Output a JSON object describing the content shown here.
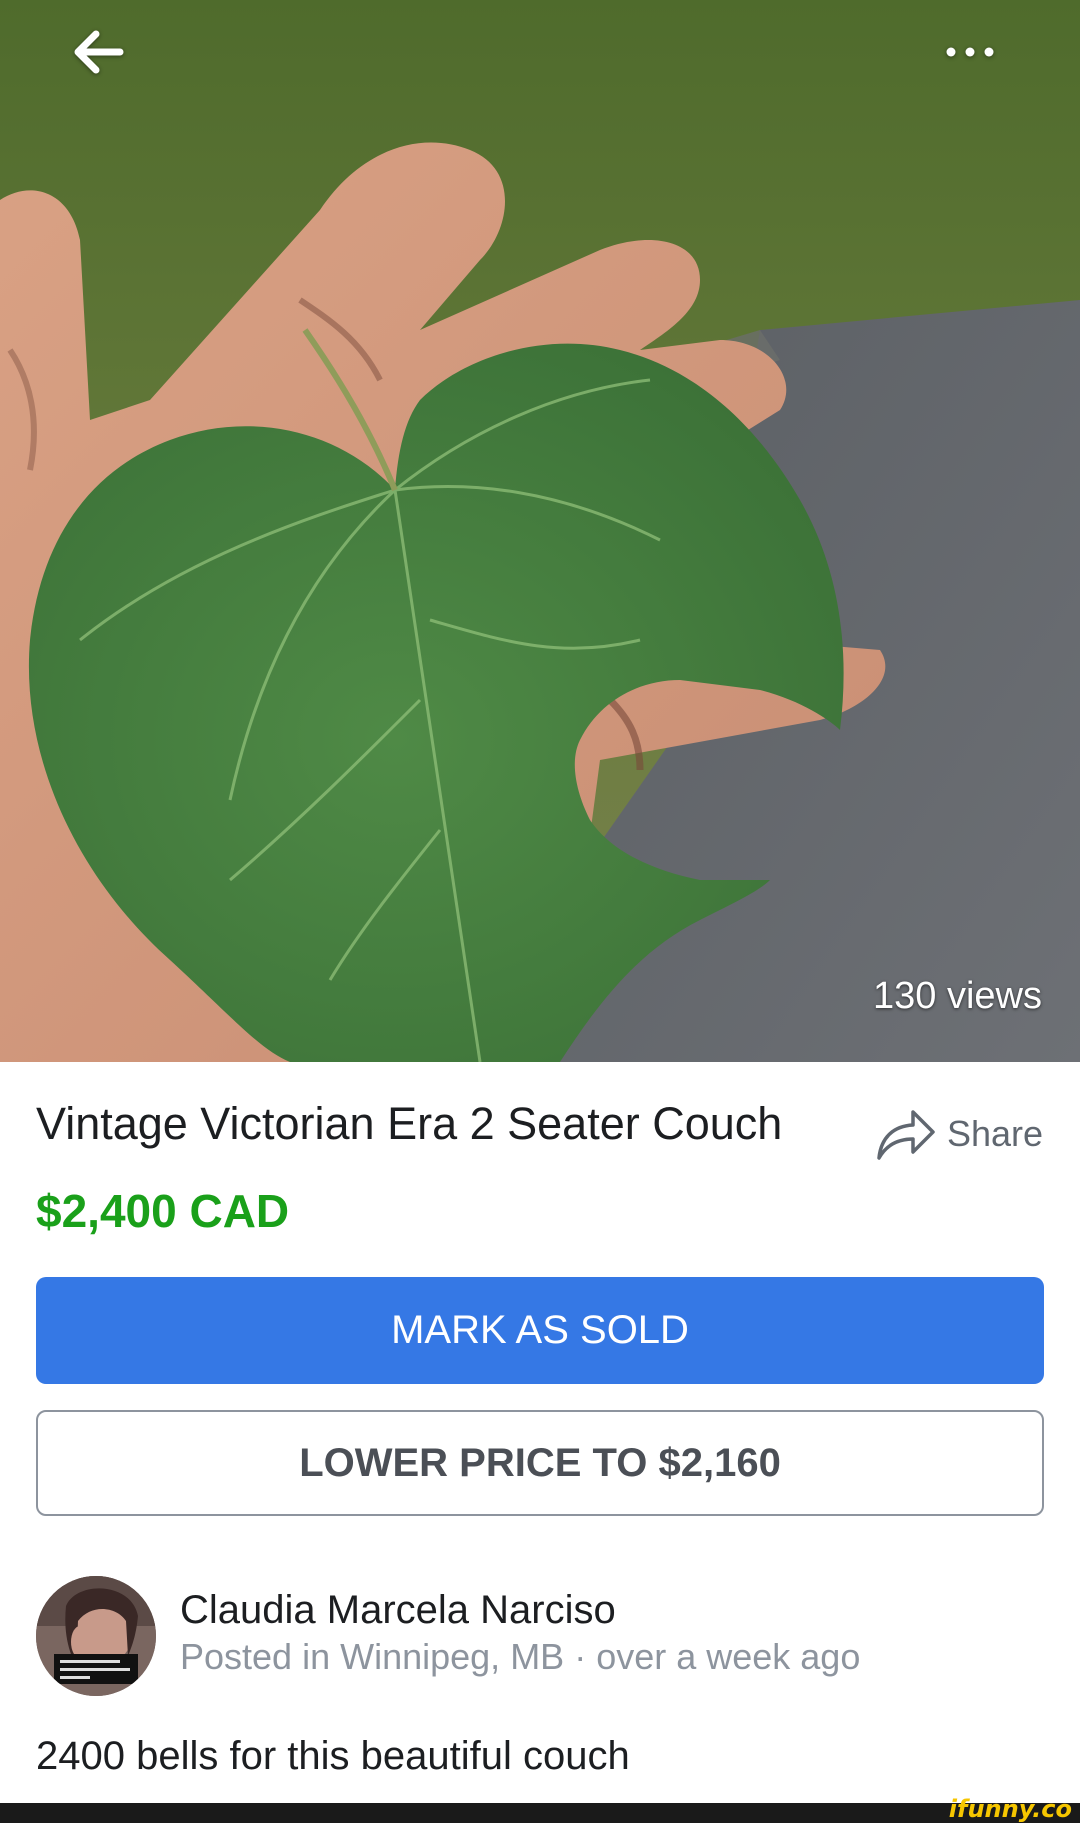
{
  "photo": {
    "views": "130 views",
    "back_icon": "arrow-left-icon",
    "more_icon": "more-horizontal-icon"
  },
  "listing": {
    "title": "Vintage Victorian Era 2 Seater Couch",
    "price": "$2,400 CAD",
    "share_label": "Share",
    "share_icon": "share-arrow-icon",
    "price_color": "#1aa01a"
  },
  "actions": {
    "mark_sold": "MARK AS SOLD",
    "lower_price": "LOWER PRICE TO $2,160",
    "primary_color": "#3578e5"
  },
  "seller": {
    "name": "Claudia Marcela Narciso",
    "location": "Posted in Winnipeg, MB",
    "separator": " · ",
    "posted": "over a week ago"
  },
  "description": "2400 bells for this beautiful couch",
  "watermark": "ifunny.co"
}
